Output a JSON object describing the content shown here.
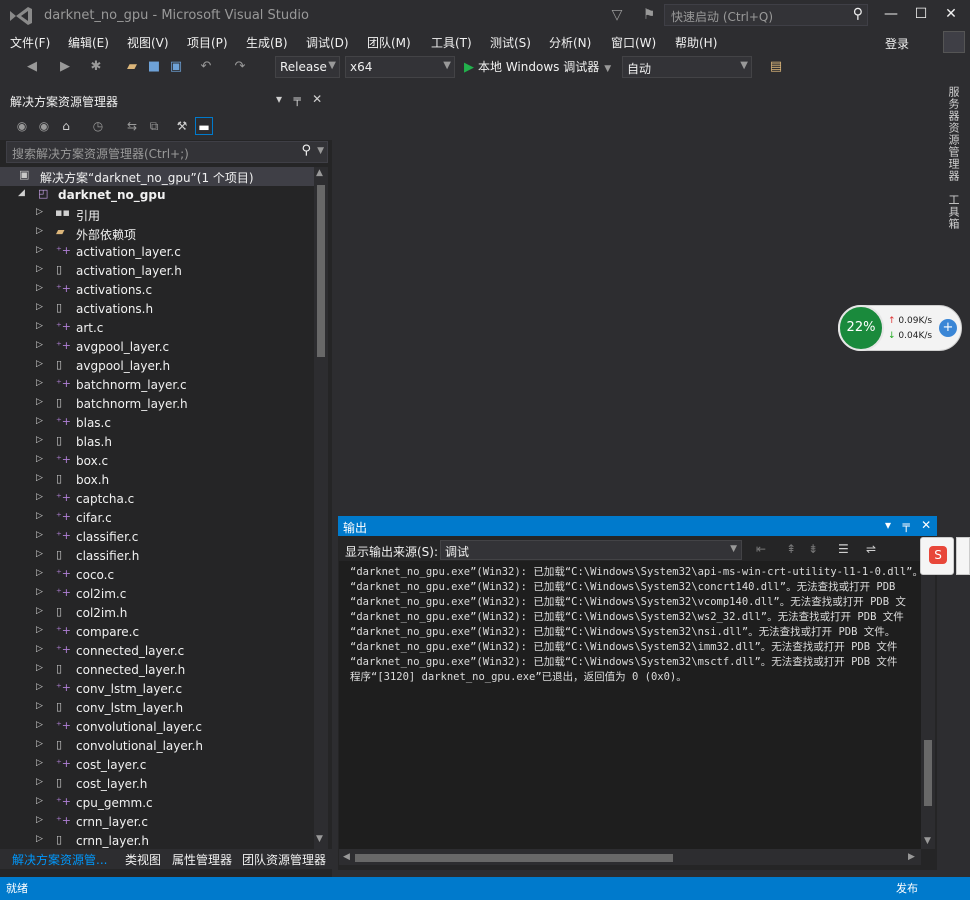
{
  "window": {
    "title": "darknet_no_gpu - Microsoft Visual Studio",
    "quick_launch_placeholder": "快速启动 (Ctrl+Q)",
    "login": "登录"
  },
  "menu": [
    "文件(F)",
    "编辑(E)",
    "视图(V)",
    "项目(P)",
    "生成(B)",
    "调试(D)",
    "团队(M)",
    "工具(T)",
    "测试(S)",
    "分析(N)",
    "窗口(W)",
    "帮助(H)"
  ],
  "toolbar": {
    "configuration": "Release",
    "platform": "x64",
    "run_label": "本地 Windows 调试器",
    "mode": "自动"
  },
  "side_tabs": {
    "server_explorer": "服务器资源管理器",
    "toolbox": "工具箱"
  },
  "solution_explorer": {
    "title": "解决方案资源管理器",
    "search_placeholder": "搜索解决方案资源管理器(Ctrl+;)",
    "solution_label": "解决方案“darknet_no_gpu”(1 个项目)",
    "project_label": "darknet_no_gpu",
    "references_label": "引用",
    "external_deps_label": "外部依赖项",
    "files": [
      {
        "name": "activation_layer.c",
        "kind": "c"
      },
      {
        "name": "activation_layer.h",
        "kind": "h"
      },
      {
        "name": "activations.c",
        "kind": "c"
      },
      {
        "name": "activations.h",
        "kind": "h"
      },
      {
        "name": "art.c",
        "kind": "c"
      },
      {
        "name": "avgpool_layer.c",
        "kind": "c"
      },
      {
        "name": "avgpool_layer.h",
        "kind": "h"
      },
      {
        "name": "batchnorm_layer.c",
        "kind": "c"
      },
      {
        "name": "batchnorm_layer.h",
        "kind": "h"
      },
      {
        "name": "blas.c",
        "kind": "c"
      },
      {
        "name": "blas.h",
        "kind": "h"
      },
      {
        "name": "box.c",
        "kind": "c"
      },
      {
        "name": "box.h",
        "kind": "h"
      },
      {
        "name": "captcha.c",
        "kind": "c"
      },
      {
        "name": "cifar.c",
        "kind": "c"
      },
      {
        "name": "classifier.c",
        "kind": "c"
      },
      {
        "name": "classifier.h",
        "kind": "h"
      },
      {
        "name": "coco.c",
        "kind": "c"
      },
      {
        "name": "col2im.c",
        "kind": "c"
      },
      {
        "name": "col2im.h",
        "kind": "h"
      },
      {
        "name": "compare.c",
        "kind": "c"
      },
      {
        "name": "connected_layer.c",
        "kind": "c"
      },
      {
        "name": "connected_layer.h",
        "kind": "h"
      },
      {
        "name": "conv_lstm_layer.c",
        "kind": "c"
      },
      {
        "name": "conv_lstm_layer.h",
        "kind": "h"
      },
      {
        "name": "convolutional_layer.c",
        "kind": "c"
      },
      {
        "name": "convolutional_layer.h",
        "kind": "h"
      },
      {
        "name": "cost_layer.c",
        "kind": "c"
      },
      {
        "name": "cost_layer.h",
        "kind": "h"
      },
      {
        "name": "cpu_gemm.c",
        "kind": "c"
      },
      {
        "name": "crnn_layer.c",
        "kind": "c"
      },
      {
        "name": "crnn_layer.h",
        "kind": "h"
      }
    ],
    "bottom_tabs": [
      "解决方案资源管...",
      "类视图",
      "属性管理器",
      "团队资源管理器"
    ]
  },
  "output": {
    "title": "输出",
    "source_label": "显示输出来源(S):",
    "source_value": "调试",
    "lines": [
      "“darknet_no_gpu.exe”(Win32): 已加载“C:\\Windows\\System32\\api-ms-win-crt-utility-l1-1-0.dll”。",
      "“darknet_no_gpu.exe”(Win32): 已加载“C:\\Windows\\System32\\concrt140.dll”。无法查找或打开 PDB",
      "“darknet_no_gpu.exe”(Win32): 已加载“C:\\Windows\\System32\\vcomp140.dll”。无法查找或打开 PDB 文",
      "“darknet_no_gpu.exe”(Win32): 已加载“C:\\Windows\\System32\\ws2_32.dll”。无法查找或打开 PDB 文件",
      "“darknet_no_gpu.exe”(Win32): 已加载“C:\\Windows\\System32\\nsi.dll”。无法查找或打开 PDB 文件。",
      "“darknet_no_gpu.exe”(Win32): 已加载“C:\\Windows\\System32\\imm32.dll”。无法查找或打开 PDB 文件",
      "“darknet_no_gpu.exe”(Win32): 已加载“C:\\Windows\\System32\\msctf.dll”。无法查找或打开 PDB 文件",
      "程序“[3120] darknet_no_gpu.exe”已退出，返回值为 0 (0x0)。"
    ]
  },
  "net_widget": {
    "percent": "22%",
    "up": "0.09K/s",
    "down": "0.04K/s"
  },
  "status": {
    "left": "就绪",
    "right": "发布"
  },
  "colors": {
    "accent": "#007acc",
    "background": "#2d2d30",
    "panel": "#252526",
    "c_file_icon": "#b180d7",
    "run_green": "#22b14c"
  }
}
